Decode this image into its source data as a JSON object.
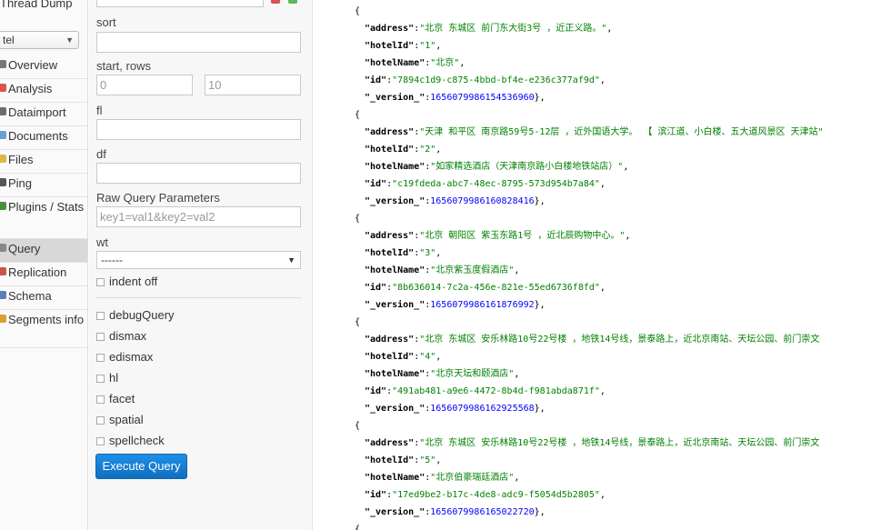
{
  "nav": {
    "thread_dump": "Thread Dump",
    "core_selected": "tel",
    "items": [
      {
        "label": "Overview",
        "icon": "dashboard-icon",
        "color": "#777777"
      },
      {
        "label": "Analysis",
        "icon": "funnel-icon",
        "color": "#d9534f"
      },
      {
        "label": "Dataimport",
        "icon": "import-icon",
        "color": "#6c6c6c"
      },
      {
        "label": "Documents",
        "icon": "documents-icon",
        "color": "#6a9fd1"
      },
      {
        "label": "Files",
        "icon": "folder-icon",
        "color": "#e0b64a"
      },
      {
        "label": "Ping",
        "icon": "ping-icon",
        "color": "#555555"
      },
      {
        "label": "Plugins / Stats",
        "icon": "plugins-icon",
        "color": "#4a8f3f"
      },
      {
        "label": "Query",
        "icon": "query-icon",
        "color": "#888888"
      },
      {
        "label": "Replication",
        "icon": "replication-icon",
        "color": "#c9554a"
      },
      {
        "label": "Schema",
        "icon": "schema-icon",
        "color": "#5a7fb8"
      },
      {
        "label": "Segments info",
        "icon": "segments-icon",
        "color": "#d8a032"
      }
    ],
    "active": "Query"
  },
  "form": {
    "sort_label": "sort",
    "sort_value": "",
    "start_rows_label": "start, rows",
    "start_value": "0",
    "rows_value": "10",
    "fl_label": "fl",
    "fl_value": "",
    "df_label": "df",
    "df_value": "",
    "raw_label": "Raw Query Parameters",
    "raw_placeholder": "key1=val1&key2=val2",
    "wt_label": "wt",
    "wt_value": "------",
    "indent_label": "indent off",
    "checkboxes": [
      "debugQuery",
      "dismax",
      "edismax",
      "hl",
      "facet",
      "spatial",
      "spellcheck"
    ],
    "execute_label": "Execute Query",
    "accent": "#1a82d6"
  },
  "result": {
    "lines": [
      {
        "type": "brace",
        "text": "{"
      },
      {
        "type": "kv",
        "key": "\"address\"",
        "value": "\"北京 东城区 前门东大街3号 ，近正义路。\"",
        "vtype": "s",
        "end": ","
      },
      {
        "type": "kv",
        "key": "\"hotelId\"",
        "value": "\"1\"",
        "vtype": "s",
        "end": ","
      },
      {
        "type": "kv",
        "key": "\"hotelName\"",
        "value": "\"北京\"",
        "vtype": "s",
        "end": ","
      },
      {
        "type": "kv",
        "key": "\"id\"",
        "value": "\"7894c1d9-c875-4bbd-bf4e-e236c377af9d\"",
        "vtype": "s",
        "end": ","
      },
      {
        "type": "kv",
        "key": "\"_version_\"",
        "value": "1656079986154536960",
        "vtype": "n",
        "end": "},"
      },
      {
        "type": "brace",
        "text": "{"
      },
      {
        "type": "kv",
        "key": "\"address\"",
        "value": "\"天津 和平区 南京路59号5-12层 ，近外国语大学。 【 滨江道、小白楼、五大道风景区 天津站\"",
        "vtype": "s",
        "end": ""
      },
      {
        "type": "kv",
        "key": "\"hotelId\"",
        "value": "\"2\"",
        "vtype": "s",
        "end": ","
      },
      {
        "type": "kv",
        "key": "\"hotelName\"",
        "value": "\"如家精选酒店（天津南京路小白楼地铁站店）\"",
        "vtype": "s",
        "end": ","
      },
      {
        "type": "kv",
        "key": "\"id\"",
        "value": "\"c19fdeda-abc7-48ec-8795-573d954b7a84\"",
        "vtype": "s",
        "end": ","
      },
      {
        "type": "kv",
        "key": "\"_version_\"",
        "value": "1656079986160828416",
        "vtype": "n",
        "end": "},"
      },
      {
        "type": "brace",
        "text": "{"
      },
      {
        "type": "kv",
        "key": "\"address\"",
        "value": "\"北京 朝阳区 紫玉东路1号 ，近北辰购物中心。\"",
        "vtype": "s",
        "end": ","
      },
      {
        "type": "kv",
        "key": "\"hotelId\"",
        "value": "\"3\"",
        "vtype": "s",
        "end": ","
      },
      {
        "type": "kv",
        "key": "\"hotelName\"",
        "value": "\"北京紫玉度假酒店\"",
        "vtype": "s",
        "end": ","
      },
      {
        "type": "kv",
        "key": "\"id\"",
        "value": "\"8b636014-7c2a-456e-821e-55ed6736f8fd\"",
        "vtype": "s",
        "end": ","
      },
      {
        "type": "kv",
        "key": "\"_version_\"",
        "value": "1656079986161876992",
        "vtype": "n",
        "end": "},"
      },
      {
        "type": "brace",
        "text": "{"
      },
      {
        "type": "kv",
        "key": "\"address\"",
        "value": "\"北京 东城区 安乐林路10号22号楼 ，地铁14号线，景泰路上，近北京南站、天坛公园、前门崇文",
        "vtype": "s",
        "end": ""
      },
      {
        "type": "kv",
        "key": "\"hotelId\"",
        "value": "\"4\"",
        "vtype": "s",
        "end": ","
      },
      {
        "type": "kv",
        "key": "\"hotelName\"",
        "value": "\"北京天坛和颐酒店\"",
        "vtype": "s",
        "end": ","
      },
      {
        "type": "kv",
        "key": "\"id\"",
        "value": "\"491ab481-a9e6-4472-8b4d-f981abda871f\"",
        "vtype": "s",
        "end": ","
      },
      {
        "type": "kv",
        "key": "\"_version_\"",
        "value": "1656079986162925568",
        "vtype": "n",
        "end": "},"
      },
      {
        "type": "brace",
        "text": "{"
      },
      {
        "type": "kv",
        "key": "\"address\"",
        "value": "\"北京 东城区 安乐林路10号22号楼 ，地铁14号线，景泰路上，近北京南站、天坛公园、前门崇文",
        "vtype": "s",
        "end": ""
      },
      {
        "type": "kv",
        "key": "\"hotelId\"",
        "value": "\"5\"",
        "vtype": "s",
        "end": ","
      },
      {
        "type": "kv",
        "key": "\"hotelName\"",
        "value": "\"北京伯豪瑞廷酒店\"",
        "vtype": "s",
        "end": ","
      },
      {
        "type": "kv",
        "key": "\"id\"",
        "value": "\"17ed9be2-b17c-4de8-adc9-f5054d5b2805\"",
        "vtype": "s",
        "end": ","
      },
      {
        "type": "kv",
        "key": "\"_version_\"",
        "value": "1656079986165022720",
        "vtype": "n",
        "end": "},"
      },
      {
        "type": "brace",
        "text": "{"
      }
    ]
  }
}
